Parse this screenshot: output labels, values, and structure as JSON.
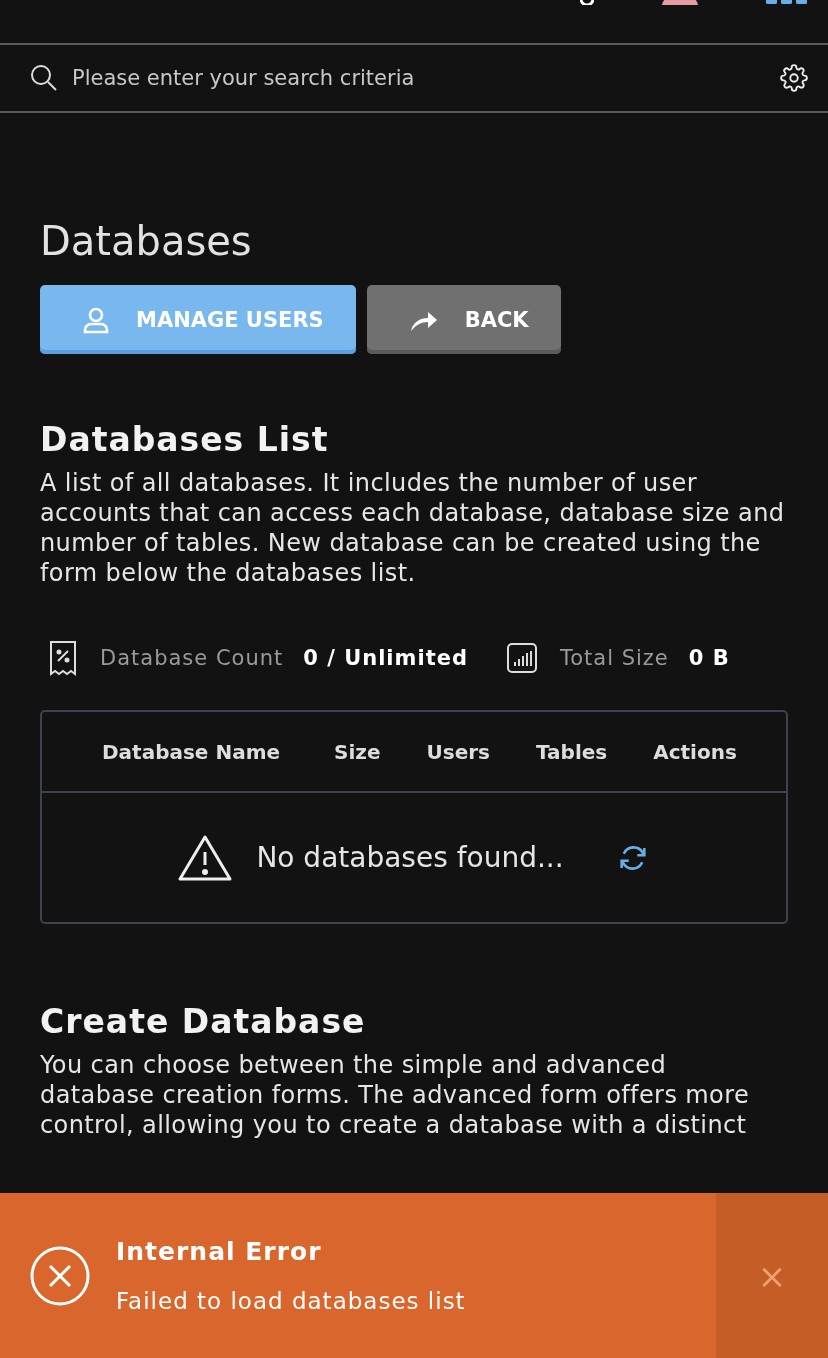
{
  "search": {
    "placeholder": "Please enter your search criteria"
  },
  "page_title": "Databases",
  "buttons": [
    {
      "label": "MANAGE USERS",
      "kind": "primary"
    },
    {
      "label": "BACK",
      "kind": "secondary"
    }
  ],
  "list_section": {
    "title": "Databases List",
    "description": "A list of all databases. It includes the number of user accounts that can access each database, database size and number of tables. New database can be created using the form below the databases list."
  },
  "stats": [
    {
      "label": "Database Count",
      "value": "0 / Unlimited",
      "kind": "count"
    },
    {
      "label": "Total Size",
      "value": "0 B",
      "kind": "size"
    }
  ],
  "table": {
    "columns": [
      "Database Name",
      "Size",
      "Users",
      "Tables",
      "Actions"
    ],
    "empty_message": "No databases found..."
  },
  "create_section": {
    "title": "Create Database",
    "description": "You can choose between the simple and advanced database creation forms. The advanced form offers more control, allowing you to create a database with a distinct"
  },
  "toast": {
    "title": "Internal Error",
    "message": "Failed to load databases list",
    "close": "×"
  }
}
